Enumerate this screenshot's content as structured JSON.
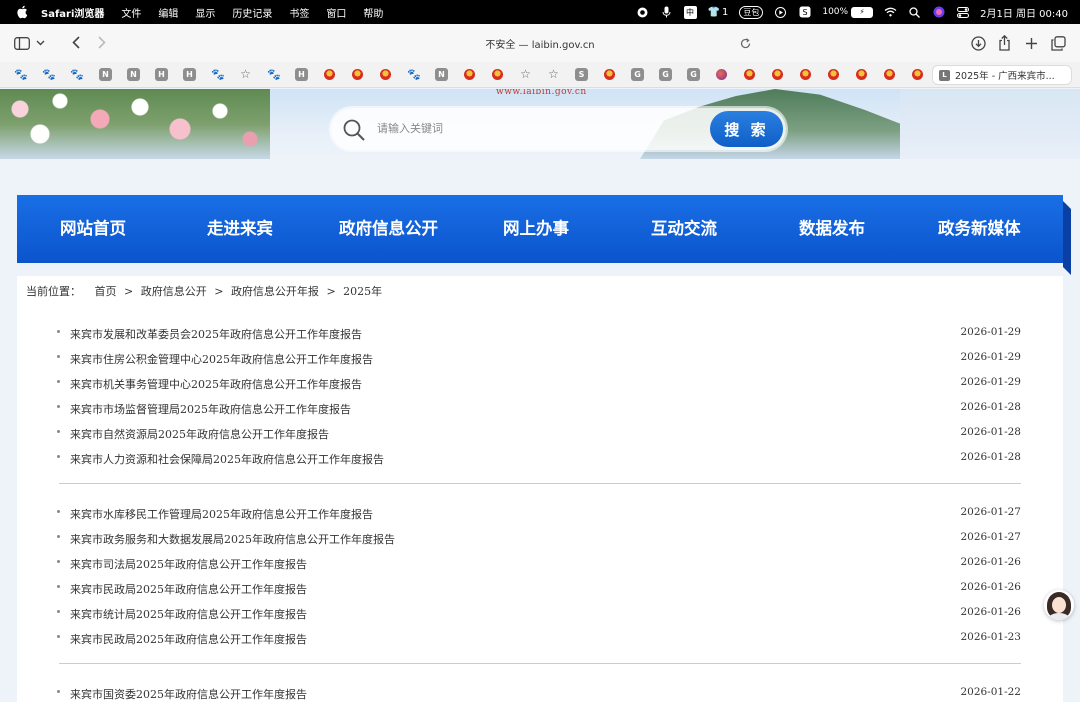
{
  "menubar": {
    "app_name": "Safari浏览器",
    "items": [
      "文件",
      "编辑",
      "显示",
      "历史记录",
      "书签",
      "窗口",
      "帮助"
    ],
    "status": {
      "input_method": "中",
      "shirt_count": "1",
      "badge": "豆包",
      "battery": "100%",
      "clock": "2月1日 周日 00:40"
    }
  },
  "toolbar": {
    "address": "不安全 — laibin.gov.cn"
  },
  "favorites": {
    "letters": [
      "N",
      "N",
      "H",
      "H",
      "H",
      "N",
      "S",
      "G",
      "G",
      "G"
    ],
    "tab_title": "2025年 - 广西来宾市...",
    "tab_favicon_letter": "L"
  },
  "banner": {
    "site_url": "www.laibin.gov.cn"
  },
  "search": {
    "placeholder": "请输入关键词",
    "button_label": "搜 索"
  },
  "nav": {
    "items": [
      "网站首页",
      "走进来宾",
      "政府信息公开",
      "网上办事",
      "互动交流",
      "数据发布",
      "政务新媒体"
    ]
  },
  "breadcrumb": {
    "label": "当前位置：",
    "items": [
      "首页",
      "政府信息公开",
      "政府信息公开年报",
      "2025年"
    ],
    "separator": ">"
  },
  "list": {
    "groups": [
      [
        {
          "title": "来宾市发展和改革委员会2025年政府信息公开工作年度报告",
          "date": "2026-01-29"
        },
        {
          "title": "来宾市住房公积金管理中心2025年政府信息公开工作年度报告",
          "date": "2026-01-29"
        },
        {
          "title": "来宾市机关事务管理中心2025年政府信息公开工作年度报告",
          "date": "2026-01-29"
        },
        {
          "title": "来宾市市场监督管理局2025年政府信息公开工作年度报告",
          "date": "2026-01-28"
        },
        {
          "title": "来宾市自然资源局2025年政府信息公开工作年度报告",
          "date": "2026-01-28"
        },
        {
          "title": "来宾市人力资源和社会保障局2025年政府信息公开工作年度报告",
          "date": "2026-01-28"
        }
      ],
      [
        {
          "title": "来宾市水库移民工作管理局2025年政府信息公开工作年度报告",
          "date": "2026-01-27"
        },
        {
          "title": "来宾市政务服务和大数据发展局2025年政府信息公开工作年度报告",
          "date": "2026-01-27"
        },
        {
          "title": "来宾市司法局2025年政府信息公开工作年度报告",
          "date": "2026-01-26"
        },
        {
          "title": "来宾市民政局2025年政府信息公开工作年度报告",
          "date": "2026-01-26"
        },
        {
          "title": "来宾市统计局2025年政府信息公开工作年度报告",
          "date": "2026-01-26"
        },
        {
          "title": "来宾市民政局2025年政府信息公开工作年度报告",
          "date": "2026-01-23"
        }
      ],
      [
        {
          "title": "来宾市国资委2025年政府信息公开工作年度报告",
          "date": "2026-01-22"
        }
      ]
    ]
  }
}
